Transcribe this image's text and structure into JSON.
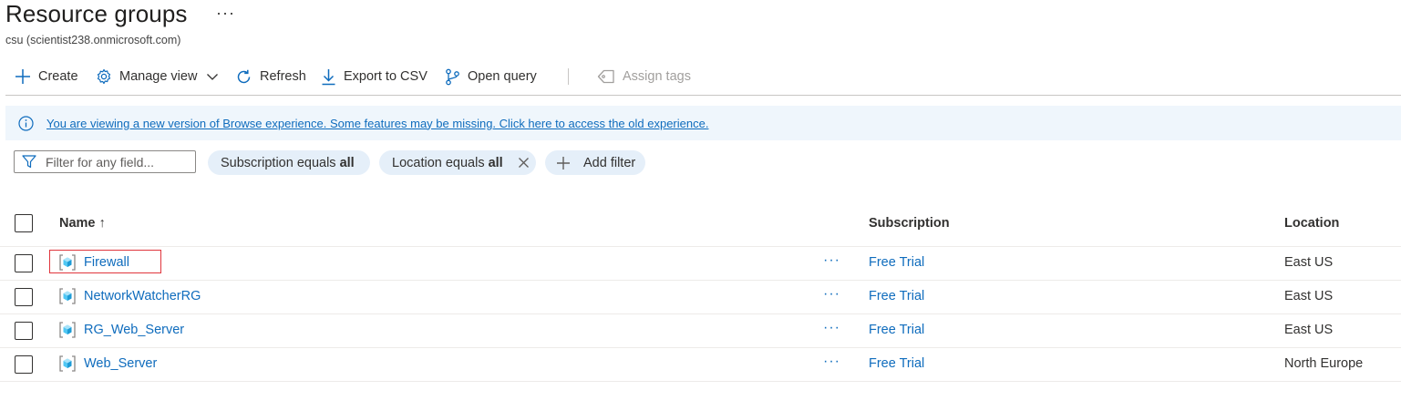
{
  "header": {
    "title": "Resource groups",
    "more": "···",
    "subtitle": "csu (scientist238.onmicrosoft.com)"
  },
  "toolbar": {
    "create": "Create",
    "manage_view": "Manage view",
    "refresh": "Refresh",
    "export_csv": "Export to CSV",
    "open_query": "Open query",
    "assign_tags": "Assign tags"
  },
  "banner": {
    "text": "You are viewing a new version of Browse experience. Some features may be missing. Click here to access the old experience."
  },
  "filters": {
    "search_placeholder": "Filter for any field...",
    "subscription_label": "Subscription equals",
    "subscription_value": "all",
    "location_label": "Location equals",
    "location_value": "all",
    "add_filter": "Add filter"
  },
  "table": {
    "columns": {
      "name": "Name ↑",
      "subscription": "Subscription",
      "location": "Location"
    },
    "rows": [
      {
        "name": "Firewall",
        "more": "···",
        "subscription": "Free Trial",
        "location": "East US",
        "highlighted": true
      },
      {
        "name": "NetworkWatcherRG",
        "more": "···",
        "subscription": "Free Trial",
        "location": "East US"
      },
      {
        "name": "RG_Web_Server",
        "more": "···",
        "subscription": "Free Trial",
        "location": "East US"
      },
      {
        "name": "Web_Server",
        "more": "···",
        "subscription": "Free Trial",
        "location": "North Europe"
      }
    ]
  },
  "icons": {
    "create": "plus-icon",
    "manage_view": "gear-icon",
    "refresh": "refresh-icon",
    "export": "download-icon",
    "query": "query-icon",
    "tags": "tag-icon",
    "info": "info-icon",
    "filter": "funnel-icon",
    "row": "resource-group-icon"
  },
  "colors": {
    "link": "#0f6cbd",
    "banner_bg": "#eff6fc",
    "pill_bg": "#e5eff9",
    "highlight": "#e0353c"
  }
}
